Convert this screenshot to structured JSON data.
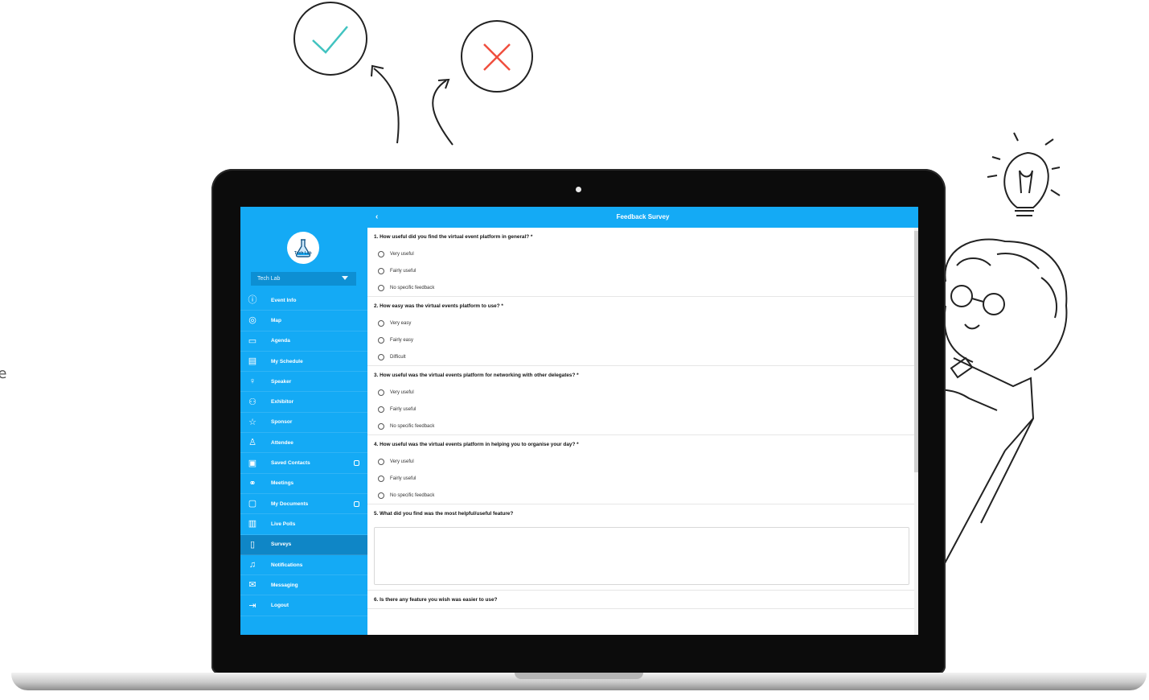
{
  "app": {
    "logo_text": "Tech Lab",
    "event_selector": "Tech Lab",
    "screen_title": "Feedback Survey",
    "back_glyph": "‹"
  },
  "sidebar": {
    "items": [
      {
        "label": "Event Info",
        "icon": "info-icon",
        "glyph": "ⓘ"
      },
      {
        "label": "Map",
        "icon": "compass-icon",
        "glyph": "◎"
      },
      {
        "label": "Agenda",
        "icon": "calendar-icon",
        "glyph": "▭"
      },
      {
        "label": "My Schedule",
        "icon": "schedule-icon",
        "glyph": "▤"
      },
      {
        "label": "Speaker",
        "icon": "microphone-icon",
        "glyph": "♀"
      },
      {
        "label": "Exhibitor",
        "icon": "people-icon",
        "glyph": "⚇"
      },
      {
        "label": "Sponsor",
        "icon": "star-icon",
        "glyph": "☆"
      },
      {
        "label": "Attendee",
        "icon": "user-icon",
        "glyph": "♙"
      },
      {
        "label": "Saved Contacts",
        "icon": "contact-card-icon",
        "glyph": "▣"
      },
      {
        "label": "Meetings",
        "icon": "handshake-icon",
        "glyph": "⚭"
      },
      {
        "label": "My Documents",
        "icon": "folder-icon",
        "glyph": "▢"
      },
      {
        "label": "Live Polls",
        "icon": "poll-icon",
        "glyph": "▥"
      },
      {
        "label": "Surveys",
        "icon": "survey-icon",
        "glyph": "▯"
      },
      {
        "label": "Notifications",
        "icon": "bell-icon",
        "glyph": "♫"
      },
      {
        "label": "Messaging",
        "icon": "envelope-icon",
        "glyph": "✉"
      },
      {
        "label": "Logout",
        "icon": "logout-icon",
        "glyph": "⇥"
      }
    ],
    "active": "Surveys"
  },
  "survey": {
    "questions": [
      {
        "text": "1. How useful did you find the virtual event platform in general? *",
        "options": [
          "Very useful",
          "Fairly useful",
          "No specific feedback"
        ]
      },
      {
        "text": "2. How easy was the virtual events platform to use? *",
        "options": [
          "Very easy",
          "Fairly easy",
          "Difficult"
        ]
      },
      {
        "text": "3. How useful was the virtual events platform for networking with other delegates? *",
        "options": [
          "Very useful",
          "Fairly useful",
          "No specific feedback"
        ]
      },
      {
        "text": "4. How useful was the virtual events platform in helping you to organise your day? *",
        "options": [
          "Very useful",
          "Fairly useful",
          "No specific feedback"
        ]
      },
      {
        "text": "5. What did you find was the most helpful/useful feature?",
        "options": []
      },
      {
        "text": "6. Is there any feature you wish was easier to use?",
        "options": []
      }
    ]
  },
  "colors": {
    "brand": "#14aaf5",
    "active_item": "#0f86c6",
    "check": "#41c3c0",
    "cross": "#f04e3e"
  },
  "edge_text": [
    "g",
    "ge"
  ]
}
